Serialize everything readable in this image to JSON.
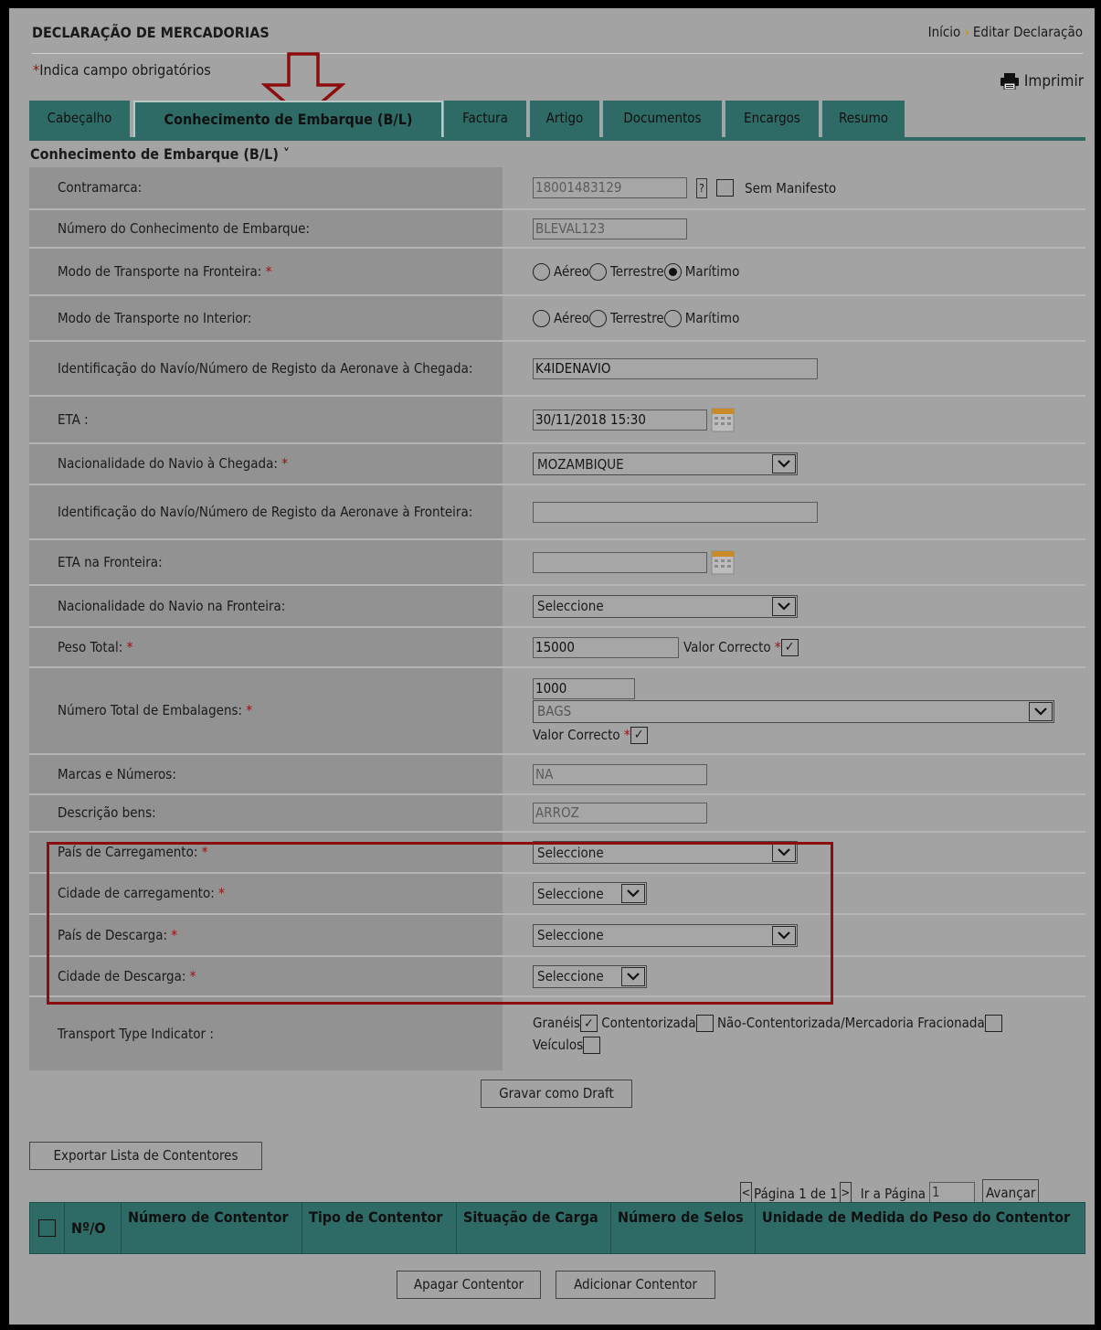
{
  "header": {
    "title": "DECLARAÇÃO DE MERCADORIAS",
    "breadcrumb_home": "Início",
    "breadcrumb_separator": "›",
    "breadcrumb_current": "Editar Declaração"
  },
  "required_note": {
    "star": "*",
    "text": "Indica campo obrigatórios"
  },
  "print_label": "Imprimir",
  "tabs": [
    "Cabeçalho",
    "Conhecimento de Embarque (B/L)",
    "Factura",
    "Artigo",
    "Documentos",
    "Encargos",
    "Resumo"
  ],
  "section_title": "Conhecimento de Embarque (B/L)",
  "section_caret": "˅",
  "form": {
    "contramarca_label": "Contramarca:",
    "contramarca_value": "18001483129",
    "help": "?",
    "sem_manifesto": "Sem Manifesto",
    "numero_conhecimento_label": "Número do Conhecimento de Embarque:",
    "numero_conhecimento_value": "BLEVAL123",
    "modo_fronteira_label": "Modo de Transporte na Fronteira:",
    "modo_interior_label": "Modo de Transporte no Interior:",
    "transport_options": [
      "Aéreo",
      "Terrestre",
      "Marítimo"
    ],
    "modo_fronteira_selected": "Marítimo",
    "modo_interior_selected": "",
    "id_navio_chegada_label": "Identificação do Navío/Número de Registo da Aeronave à Chegada:",
    "id_navio_chegada_value": "K4IDENAVIO",
    "eta_label": "ETA :",
    "eta_value": "30/11/2018 15:30",
    "nacionalidade_chegada_label": "Nacionalidade do Navio à Chegada:",
    "nacionalidade_chegada_value": "MOZAMBIQUE",
    "id_navio_fronteira_label": "Identificação do Navío/Número de Registo da Aeronave à Fronteira:",
    "id_navio_fronteira_value": "",
    "eta_fronteira_label": "ETA na Fronteira:",
    "eta_fronteira_value": "",
    "nacionalidade_fronteira_label": "Nacionalidade do Navio na Fronteira:",
    "nacionalidade_fronteira_value": "Seleccione",
    "peso_total_label": "Peso Total:",
    "peso_total_value": "15000",
    "valor_correcto": "Valor Correcto",
    "peso_valor_correcto_checked": true,
    "num_embalagens_label": "Número Total de Embalagens:",
    "num_embalagens_value": "1000",
    "tipo_embalagem_value": "BAGS",
    "embalagens_valor_correcto_checked": true,
    "marcas_label": "Marcas e Números:",
    "marcas_value": "NA",
    "descricao_label": "Descrição bens:",
    "descricao_value": "ARROZ",
    "pais_carregamento_label": "País de Carregamento:",
    "pais_carregamento_value": "Seleccione",
    "cidade_carregamento_label": "Cidade de carregamento:",
    "cidade_carregamento_value": "Seleccione",
    "pais_descarga_label": "País de Descarga:",
    "pais_descarga_value": "Seleccione",
    "cidade_descarga_label": "Cidade de Descarga:",
    "cidade_descarga_value": "Seleccione",
    "transport_type_label": "Transport Type Indicator :",
    "tti_options": [
      {
        "label": "Granéis",
        "checked": true
      },
      {
        "label": "Contentorizada",
        "checked": false
      },
      {
        "label": "Não-Contentorizada/Mercadoria Fracionada",
        "checked": false
      },
      {
        "label": "Veículos",
        "checked": false
      }
    ]
  },
  "buttons": {
    "gravar_draft": "Gravar como Draft",
    "exportar": "Exportar Lista de Contentores",
    "avancar": "Avançar",
    "apagar": "Apagar Contentor",
    "adicionar": "Adicionar Contentor"
  },
  "pager": {
    "prev": "<",
    "next": ">",
    "page_text": "Página 1 de 1",
    "goto_label": "Ir a Página",
    "goto_value": "1"
  },
  "table": {
    "headers": [
      "Nº/O",
      "Número de Contentor",
      "Tipo de Contentor",
      "Situação de Carga",
      "Número de Selos",
      "Unidade de Medida do Peso do Contentor"
    ]
  },
  "colors": {
    "tab_teal": "#2f6b66",
    "required_star": "#a01010",
    "annotation_red": "#8b0d0d",
    "calendar_orange": "#c98a2a"
  }
}
